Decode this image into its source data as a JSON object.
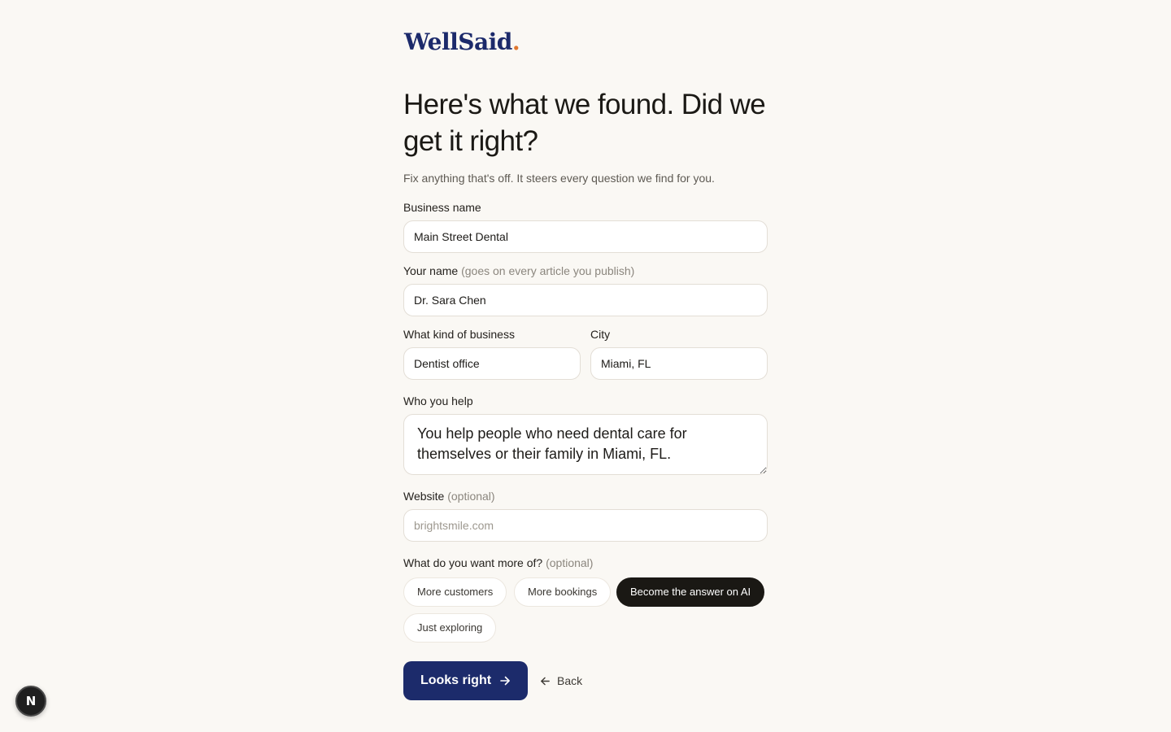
{
  "brand": {
    "name": "WellSaid",
    "dot": ".",
    "dot_color": "#e0772e",
    "color": "#1c2a6b"
  },
  "header": {
    "title": "Here's what we found. Did we get it right?",
    "subtitle": "Fix anything that's off. It steers every question we find for you."
  },
  "form": {
    "business_name": {
      "label": "Business name",
      "value": "Main Street Dental"
    },
    "your_name": {
      "label": "Your name",
      "hint": "(goes on every article you publish)",
      "value": "Dr. Sara Chen"
    },
    "business_kind": {
      "label": "What kind of business",
      "value": "Dentist office"
    },
    "city": {
      "label": "City",
      "value": "Miami, FL"
    },
    "who_you_help": {
      "label": "Who you help",
      "value": "You help people who need dental care for themselves or their family in Miami, FL."
    },
    "website": {
      "label": "Website",
      "hint": "(optional)",
      "value": "",
      "placeholder": "brightsmile.com"
    },
    "goals": {
      "label": "What do you want more of?",
      "hint": "(optional)",
      "options": [
        {
          "label": "More customers",
          "selected": false
        },
        {
          "label": "More bookings",
          "selected": false
        },
        {
          "label": "Become the answer on AI",
          "selected": true
        },
        {
          "label": "Just exploring",
          "selected": false
        }
      ]
    }
  },
  "actions": {
    "primary_label": "Looks right",
    "primary_icon": "arrow-right-icon",
    "primary_color": "#1c2b6b",
    "back_label": "Back",
    "back_icon": "arrow-left-icon"
  },
  "dev_badge": {
    "label": "N"
  }
}
